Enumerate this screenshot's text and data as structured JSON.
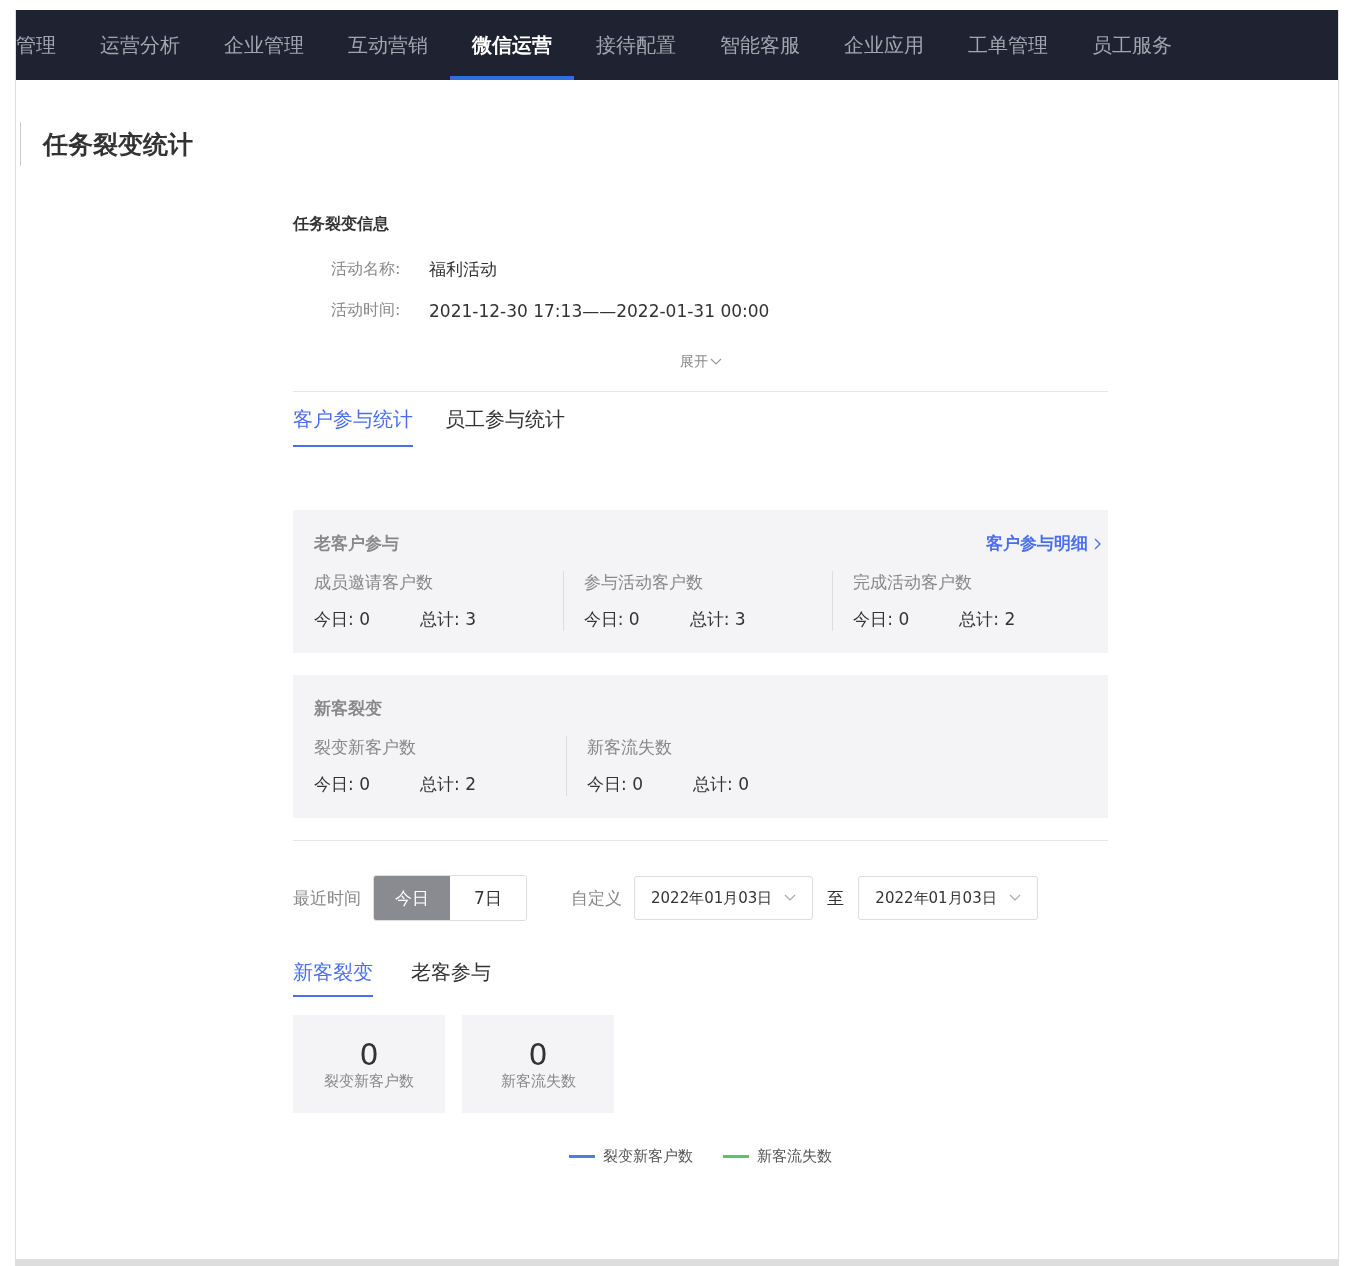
{
  "nav": {
    "items": [
      {
        "label": "管理",
        "selected": false
      },
      {
        "label": "运营分析",
        "selected": false
      },
      {
        "label": "企业管理",
        "selected": false
      },
      {
        "label": "互动营销",
        "selected": false
      },
      {
        "label": "微信运营",
        "selected": true
      },
      {
        "label": "接待配置",
        "selected": false
      },
      {
        "label": "智能客服",
        "selected": false
      },
      {
        "label": "企业应用",
        "selected": false
      },
      {
        "label": "工单管理",
        "selected": false
      },
      {
        "label": "员工服务",
        "selected": false
      }
    ]
  },
  "page_title": "任务裂变统计",
  "info": {
    "title": "任务裂变信息",
    "fields": [
      {
        "label": "活动名称:",
        "value": "福利活动"
      },
      {
        "label": "活动时间:",
        "value": "2021-12-30 17:13——2022-01-31 00:00"
      }
    ],
    "expand": "展开"
  },
  "tabs": [
    {
      "label": "客户参与统计",
      "selected": true
    },
    {
      "label": "员工参与统计",
      "selected": false
    }
  ],
  "panels": [
    {
      "title": "老客户参与",
      "link": "客户参与明细",
      "metrics": [
        {
          "name": "成员邀请客户数",
          "today": "今日: 0",
          "total": "总计: 3"
        },
        {
          "name": "参与活动客户数",
          "today": "今日: 0",
          "total": "总计: 3"
        },
        {
          "name": "完成活动客户数",
          "today": "今日: 0",
          "total": "总计: 2"
        }
      ]
    },
    {
      "title": "新客裂变",
      "metrics": [
        {
          "name": "裂变新客户数",
          "today": "今日: 0",
          "total": "总计: 2"
        },
        {
          "name": "新客流失数",
          "today": "今日: 0",
          "total": "总计: 0"
        }
      ]
    }
  ],
  "filter": {
    "recent_label": "最近时间",
    "ranges": [
      {
        "label": "今日",
        "selected": true
      },
      {
        "label": "7日",
        "selected": false
      }
    ],
    "custom_label": "自定义",
    "start": "2022年01月03日",
    "separator": "至",
    "end": "2022年01月03日"
  },
  "sub_tabs": [
    {
      "label": "新客裂变",
      "selected": true
    },
    {
      "label": "老客参与",
      "selected": false
    }
  ],
  "cards": [
    {
      "value": "0",
      "label": "裂变新客户数"
    },
    {
      "value": "0",
      "label": "新客流失数"
    }
  ],
  "legend": [
    {
      "label": "裂变新客户数",
      "color": "#4a7ee8"
    },
    {
      "label": "新客流失数",
      "color": "#5cc36a"
    }
  ]
}
